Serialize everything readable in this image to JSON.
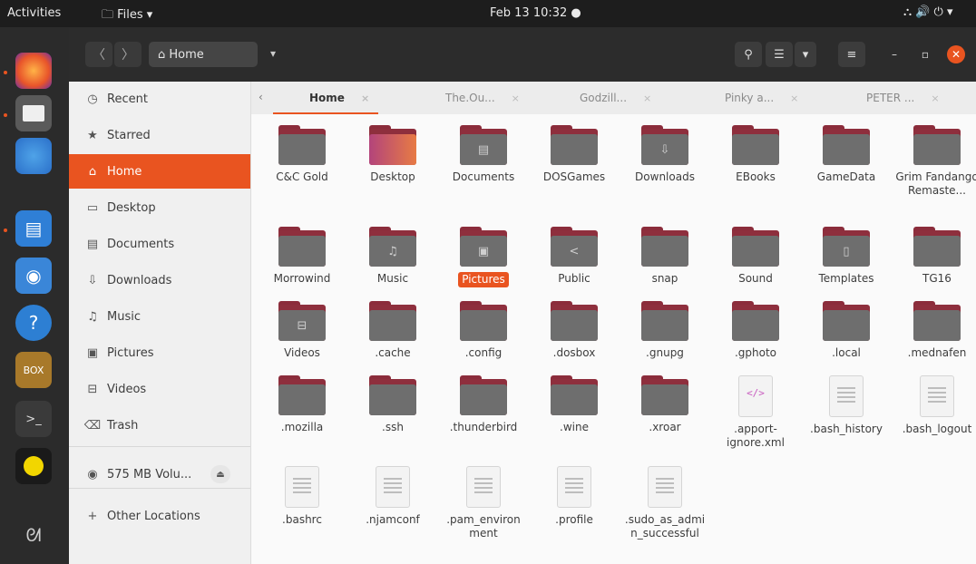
{
  "topbar": {
    "activities": "Activities",
    "app_menu": "🗀 Files ▾",
    "clock": "Feb 13  10:32  ●",
    "system": "⛬  🔊  ⏻ ▾"
  },
  "dock": {
    "icons": [
      "firefox-icon",
      "files-icon",
      "thunderbird-icon",
      "writer-icon",
      "camera-icon",
      "help-icon",
      "dosbox-icon",
      "terminal-icon",
      "pacman-icon",
      "gimp-icon"
    ]
  },
  "header": {
    "back_label": "〈",
    "forward_label": "〉",
    "path_label": "⌂  Home",
    "path_dropdown": "▾",
    "search_label": "⚲",
    "view_toggle_label": "☰",
    "view_options_label": "▾",
    "menu_label": "≡",
    "minimize_label": "–",
    "maximize_label": "▫",
    "close_label": "✕"
  },
  "sidebar": {
    "items": [
      {
        "icon": "◷",
        "label": "Recent"
      },
      {
        "icon": "★",
        "label": "Starred"
      },
      {
        "icon": "⌂",
        "label": "Home"
      },
      {
        "icon": "▭",
        "label": "Desktop"
      },
      {
        "icon": "▤",
        "label": "Documents"
      },
      {
        "icon": "⇩",
        "label": "Downloads"
      },
      {
        "icon": "♫",
        "label": "Music"
      },
      {
        "icon": "▣",
        "label": "Pictures"
      },
      {
        "icon": "⊟",
        "label": "Videos"
      },
      {
        "icon": "⌫",
        "label": "Trash"
      },
      {
        "icon": "◉",
        "label": "575 MB Volu..."
      },
      {
        "icon": "+",
        "label": "Other Locations"
      }
    ],
    "eject_label": "⏏"
  },
  "tabs": {
    "arrow": "‹",
    "items": [
      {
        "label": "Home",
        "close": "×"
      },
      {
        "label": "The.Ou...",
        "close": "×"
      },
      {
        "label": "Godzill...",
        "close": "×"
      },
      {
        "label": "Pinky a...",
        "close": "×"
      },
      {
        "label": "PETER ...",
        "close": "×"
      }
    ]
  },
  "files": [
    {
      "name": "C&C Gold",
      "kind": "folder",
      "glyph": ""
    },
    {
      "name": "Desktop",
      "kind": "desktop",
      "glyph": ""
    },
    {
      "name": "Documents",
      "kind": "folder",
      "glyph": "▤"
    },
    {
      "name": "DOSGames",
      "kind": "folder",
      "glyph": ""
    },
    {
      "name": "Downloads",
      "kind": "folder",
      "glyph": "⇩"
    },
    {
      "name": "EBooks",
      "kind": "folder",
      "glyph": ""
    },
    {
      "name": "GameData",
      "kind": "folder",
      "glyph": ""
    },
    {
      "name": "Grim Fandango Remaste...",
      "kind": "folder",
      "glyph": ""
    },
    {
      "name": "Morrowind",
      "kind": "folder",
      "glyph": ""
    },
    {
      "name": "Music",
      "kind": "folder",
      "glyph": "♫"
    },
    {
      "name": "Pictures",
      "kind": "folder",
      "glyph": "▣",
      "selected": true
    },
    {
      "name": "Public",
      "kind": "folder",
      "glyph": "<"
    },
    {
      "name": "snap",
      "kind": "folder",
      "glyph": ""
    },
    {
      "name": "Sound",
      "kind": "folder",
      "glyph": ""
    },
    {
      "name": "Templates",
      "kind": "folder",
      "glyph": "▯"
    },
    {
      "name": "TG16",
      "kind": "folder",
      "glyph": ""
    },
    {
      "name": "Videos",
      "kind": "folder",
      "glyph": "⊟"
    },
    {
      "name": ".cache",
      "kind": "folder",
      "glyph": ""
    },
    {
      "name": ".config",
      "kind": "folder",
      "glyph": ""
    },
    {
      "name": ".dosbox",
      "kind": "folder",
      "glyph": ""
    },
    {
      "name": ".gnupg",
      "kind": "folder",
      "glyph": ""
    },
    {
      "name": ".gphoto",
      "kind": "folder",
      "glyph": ""
    },
    {
      "name": ".local",
      "kind": "folder",
      "glyph": ""
    },
    {
      "name": ".mednafen",
      "kind": "folder",
      "glyph": ""
    },
    {
      "name": ".mozilla",
      "kind": "folder",
      "glyph": ""
    },
    {
      "name": ".ssh",
      "kind": "folder",
      "glyph": ""
    },
    {
      "name": ".thunderbird",
      "kind": "folder",
      "glyph": ""
    },
    {
      "name": ".wine",
      "kind": "folder",
      "glyph": ""
    },
    {
      "name": ".xroar",
      "kind": "folder",
      "glyph": ""
    },
    {
      "name": ".apport-ignore.xml",
      "kind": "xml",
      "glyph": "</>"
    },
    {
      "name": ".bash_history",
      "kind": "text",
      "glyph": ""
    },
    {
      "name": ".bash_logout",
      "kind": "text",
      "glyph": ""
    },
    {
      "name": ".bashrc",
      "kind": "text",
      "glyph": ""
    },
    {
      "name": ".njamconf",
      "kind": "text",
      "glyph": ""
    },
    {
      "name": ".pam_environment",
      "kind": "text",
      "glyph": ""
    },
    {
      "name": ".profile",
      "kind": "text",
      "glyph": ""
    },
    {
      "name": ".sudo_as_admin_successful",
      "kind": "text",
      "glyph": ""
    }
  ]
}
